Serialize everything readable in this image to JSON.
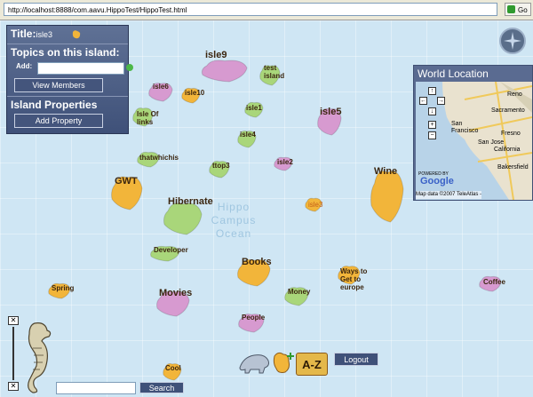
{
  "browser": {
    "url": "http://localhost:8888/com.aavu.HippoTest/HippoTest.html",
    "go_label": "Go"
  },
  "panel": {
    "title_label": "Title:",
    "title_value": "isle3",
    "topics_heading": "Topics on this island:",
    "add_label": "Add:",
    "add_value": "",
    "view_members": "View Members",
    "properties_heading": "Island Properties",
    "add_property": "Add Property"
  },
  "ocean_watermark": [
    "Hippo",
    "Campus",
    "Ocean"
  ],
  "world": {
    "title": "World Location",
    "cities": [
      "Reno",
      "Sacramento",
      "San Francisco",
      "San Jose",
      "California",
      "Fresno",
      "Bakersfield"
    ],
    "powered_by": "POWERED BY",
    "brand": "Google",
    "copyright": "Map data ©2007 TeleAtlas -"
  },
  "islands": [
    {
      "name": "isle9",
      "color": "#d79ad0"
    },
    {
      "name": "test island",
      "color": "#a9d67a"
    },
    {
      "name": "isle6",
      "color": "#d79ad0"
    },
    {
      "name": "isle10",
      "color": "#f2b53a"
    },
    {
      "name": "isle1",
      "color": "#a9d67a"
    },
    {
      "name": "isle5",
      "color": "#d79ad0"
    },
    {
      "name": "Isle Of links",
      "color": "#a9d67a"
    },
    {
      "name": "isle4",
      "color": "#a9d67a"
    },
    {
      "name": "thatwhichis",
      "color": "#a9d67a"
    },
    {
      "name": "ttop3",
      "color": "#a9d67a"
    },
    {
      "name": "isle2",
      "color": "#d79ad0"
    },
    {
      "name": "GWT",
      "color": "#f2b53a"
    },
    {
      "name": "Wine",
      "color": "#f2b53a"
    },
    {
      "name": "Hibernate",
      "color": "#a9d67a"
    },
    {
      "name": "isle3",
      "color": "#f2b53a"
    },
    {
      "name": "Developer",
      "color": "#a9d67a"
    },
    {
      "name": "Books",
      "color": "#f2b53a"
    },
    {
      "name": "Ways to Get to europe",
      "color": "#f2b53a"
    },
    {
      "name": "Spring",
      "color": "#f2b53a"
    },
    {
      "name": "Movies",
      "color": "#d79ad0"
    },
    {
      "name": "Money",
      "color": "#a9d67a"
    },
    {
      "name": "Coffee",
      "color": "#d79ad0"
    },
    {
      "name": "People",
      "color": "#d79ad0"
    },
    {
      "name": "Cool",
      "color": "#f2b53a"
    }
  ],
  "bottom": {
    "search_value": "",
    "search_button": "Search",
    "logout": "Logout",
    "az": "A-Z"
  }
}
